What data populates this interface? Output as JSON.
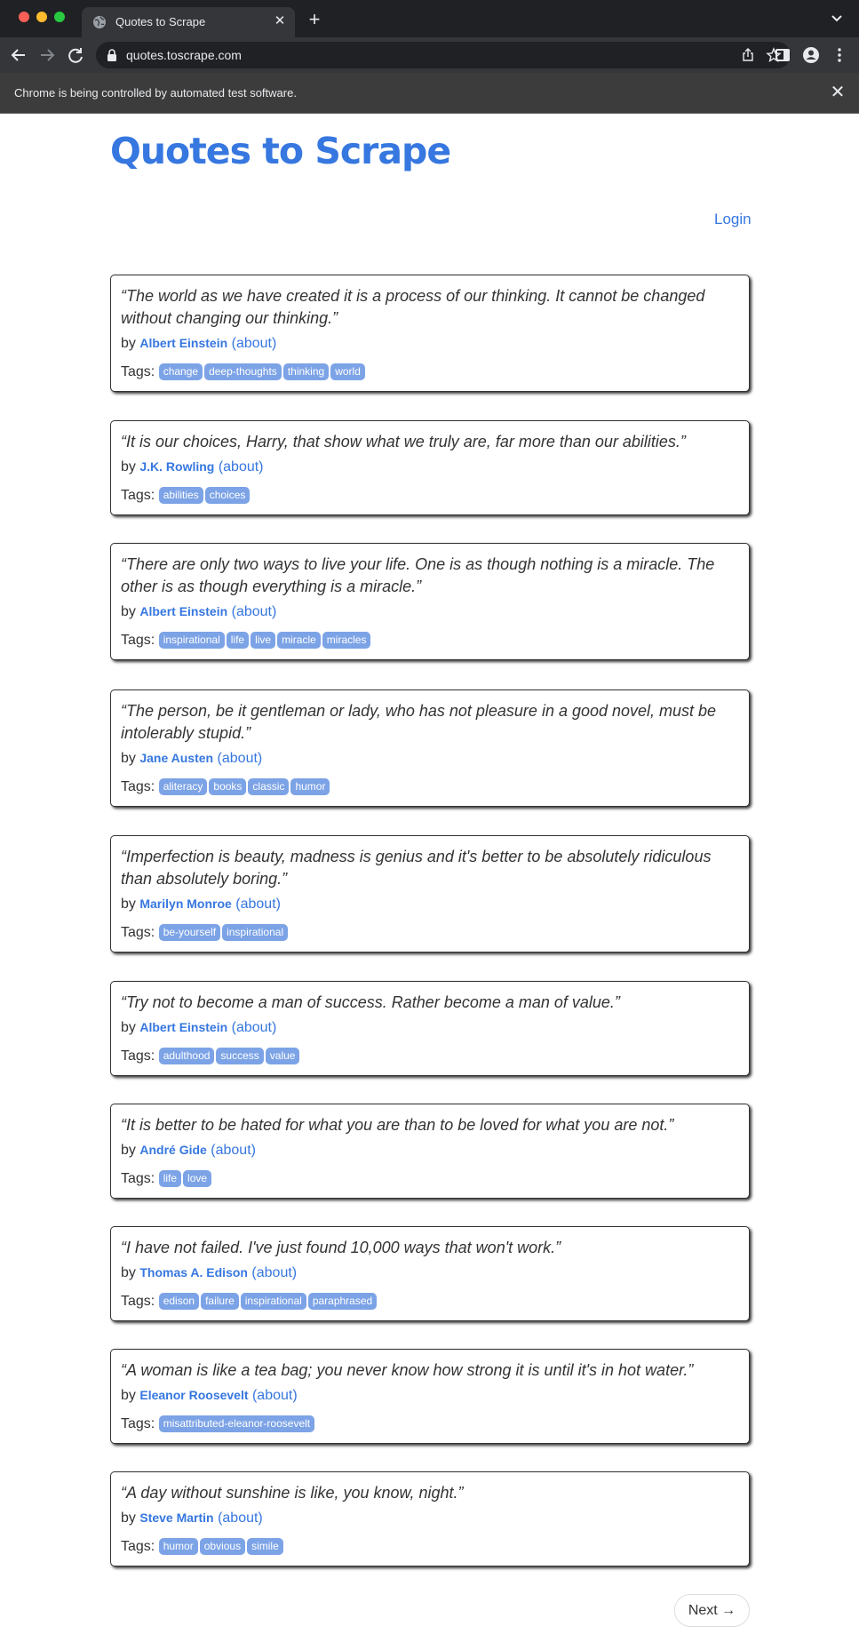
{
  "browser": {
    "tab_title": "Quotes to Scrape",
    "url": "quotes.toscrape.com",
    "infobar_text": "Chrome is being controlled by automated test software.",
    "new_tab_glyph": "+",
    "close_glyph": "✕",
    "icons": [
      "globe-icon",
      "close-icon",
      "plus-icon",
      "chevron-down-icon",
      "back-arrow-icon",
      "forward-arrow-icon",
      "reload-icon",
      "lock-icon",
      "share-icon",
      "star-icon",
      "side-panel-icon",
      "profile-icon",
      "kebab-menu-icon"
    ]
  },
  "site": {
    "title": "Quotes to Scrape",
    "login_label": "Login",
    "by_label": "by",
    "about_label": "(about)",
    "tags_label": "Tags:",
    "next_label": "Next →",
    "accent_color": "#3677e0",
    "tag_color": "#7ca3e6"
  },
  "quotes": [
    {
      "text": "“The world as we have created it is a process of our thinking. It cannot be changed without changing our thinking.”",
      "author": "Albert Einstein",
      "tags": [
        "change",
        "deep-thoughts",
        "thinking",
        "world"
      ]
    },
    {
      "text": "“It is our choices, Harry, that show what we truly are, far more than our abilities.”",
      "author": "J.K. Rowling",
      "tags": [
        "abilities",
        "choices"
      ]
    },
    {
      "text": "“There are only two ways to live your life. One is as though nothing is a miracle. The other is as though everything is a miracle.”",
      "author": "Albert Einstein",
      "tags": [
        "inspirational",
        "life",
        "live",
        "miracle",
        "miracles"
      ]
    },
    {
      "text": "“The person, be it gentleman or lady, who has not pleasure in a good novel, must be intolerably stupid.”",
      "author": "Jane Austen",
      "tags": [
        "aliteracy",
        "books",
        "classic",
        "humor"
      ]
    },
    {
      "text": "“Imperfection is beauty, madness is genius and it's better to be absolutely ridiculous than absolutely boring.”",
      "author": "Marilyn Monroe",
      "tags": [
        "be-yourself",
        "inspirational"
      ]
    },
    {
      "text": "“Try not to become a man of success. Rather become a man of value.”",
      "author": "Albert Einstein",
      "tags": [
        "adulthood",
        "success",
        "value"
      ]
    },
    {
      "text": "“It is better to be hated for what you are than to be loved for what you are not.”",
      "author": "André Gide",
      "tags": [
        "life",
        "love"
      ]
    },
    {
      "text": "“I have not failed. I've just found 10,000 ways that won't work.”",
      "author": "Thomas A. Edison",
      "tags": [
        "edison",
        "failure",
        "inspirational",
        "paraphrased"
      ]
    },
    {
      "text": "“A woman is like a tea bag; you never know how strong it is until it's in hot water.”",
      "author": "Eleanor Roosevelt",
      "tags": [
        "misattributed-eleanor-roosevelt"
      ]
    },
    {
      "text": "“A day without sunshine is like, you know, night.”",
      "author": "Steve Martin",
      "tags": [
        "humor",
        "obvious",
        "simile"
      ]
    }
  ]
}
